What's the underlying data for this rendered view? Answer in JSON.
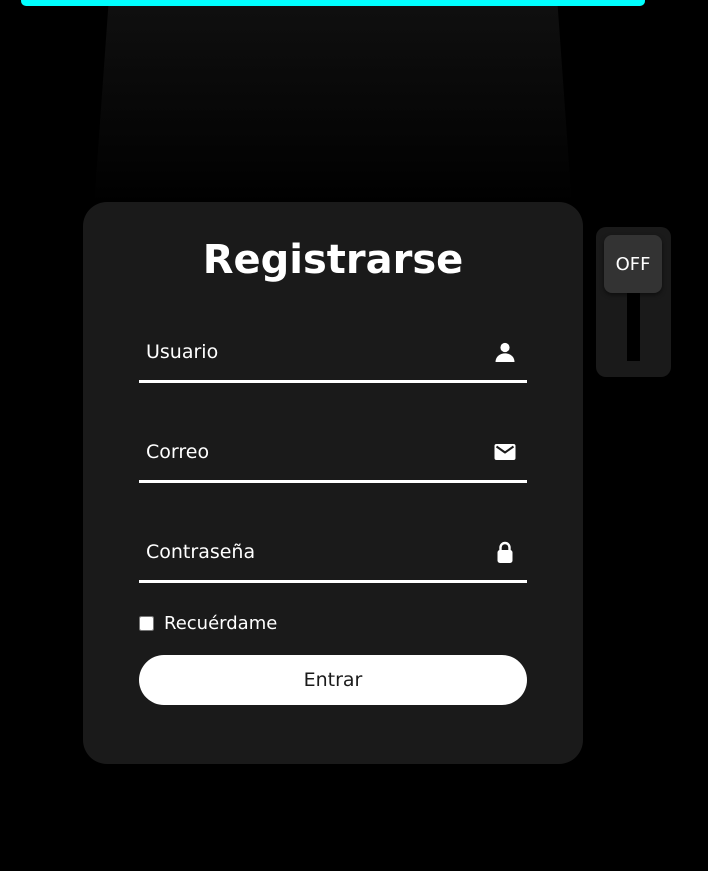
{
  "colors": {
    "background": "#000000",
    "accent_bar": "#00ffff",
    "card": "#1a1a1a",
    "text": "#ffffff",
    "button_bg": "#ffffff",
    "button_text": "#1a1a1a"
  },
  "form": {
    "title": "Registrarse",
    "fields": [
      {
        "placeholder": "Usuario",
        "value": "",
        "icon": "user-icon",
        "type": "text"
      },
      {
        "placeholder": "Correo",
        "value": "",
        "icon": "mail-icon",
        "type": "email"
      },
      {
        "placeholder": "Contraseña",
        "value": "",
        "icon": "lock-icon",
        "type": "password"
      }
    ],
    "remember_label": "Recuérdame",
    "remember_checked": false,
    "submit_label": "Entrar"
  },
  "light_switch": {
    "state_label": "OFF"
  }
}
